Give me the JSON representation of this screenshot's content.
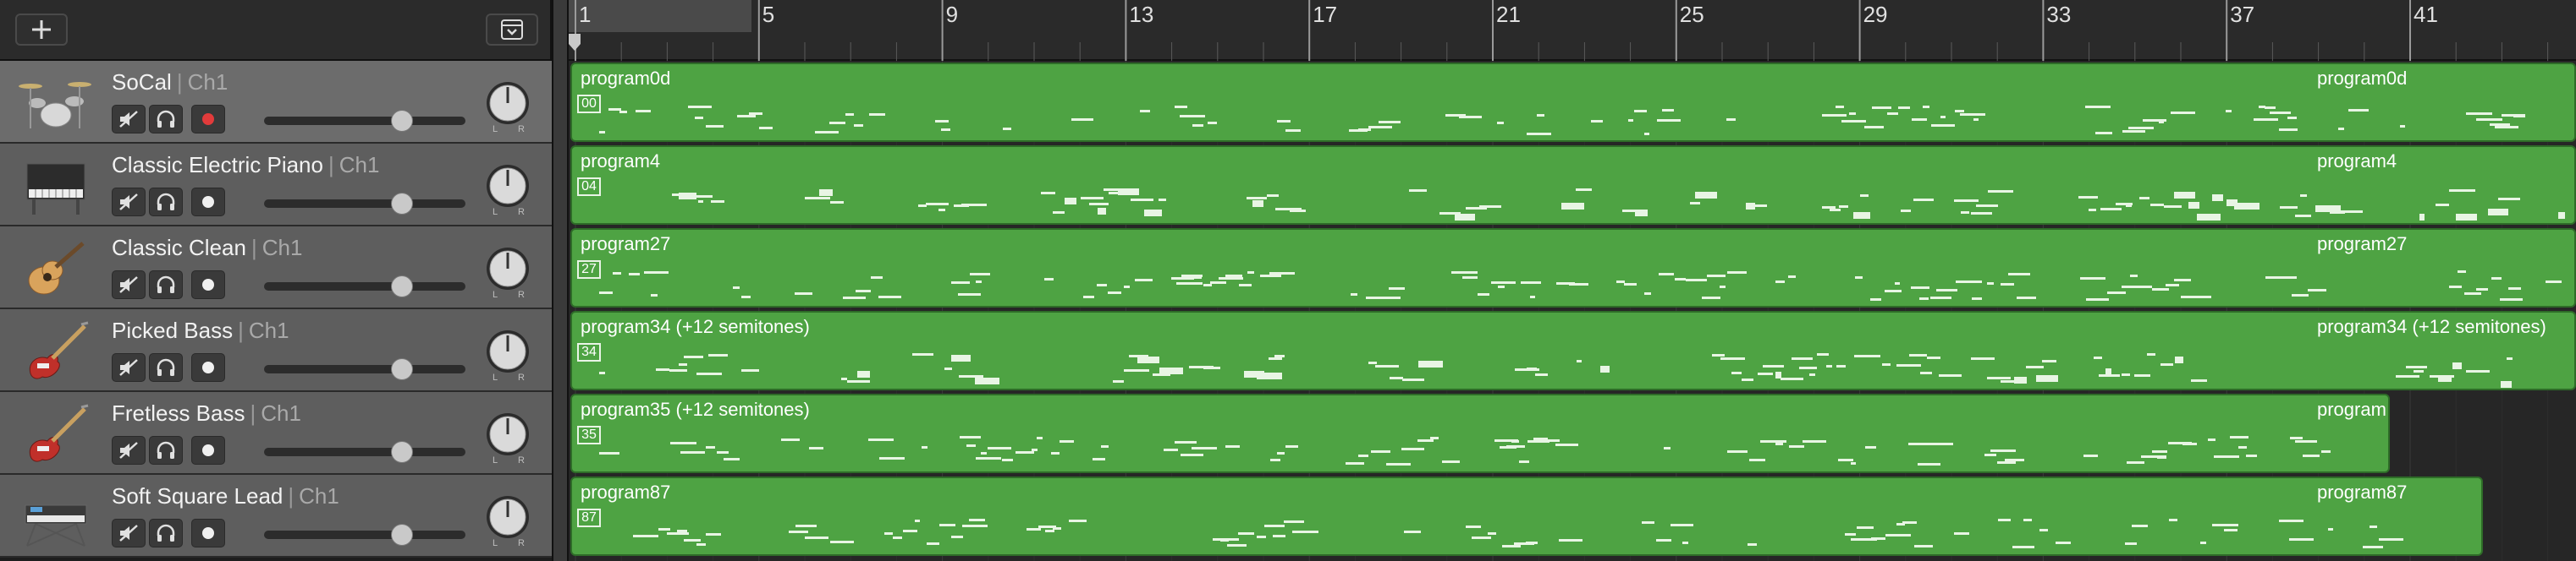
{
  "header": {
    "add_track_icon": "plus-icon",
    "collapse_icon": "chevron-down-box-icon"
  },
  "ruler": {
    "bars": [
      "1",
      "5",
      "9",
      "13",
      "17",
      "21",
      "25",
      "29",
      "33",
      "37",
      "41"
    ],
    "playhead_bar": "1"
  },
  "tracks": [
    {
      "name": "SoCal",
      "channel": "Ch1",
      "icon": "drum-kit-icon",
      "record_armed": true,
      "region": {
        "start": "program0d",
        "loop": "program0d",
        "box": "00"
      }
    },
    {
      "name": "Classic Electric Piano",
      "channel": "Ch1",
      "icon": "electric-piano-icon",
      "record_armed": false,
      "region": {
        "start": "program4",
        "loop": "program4",
        "box": "04"
      }
    },
    {
      "name": "Classic Clean",
      "channel": "Ch1",
      "icon": "guitar-icon",
      "record_armed": false,
      "region": {
        "start": "program27",
        "loop": "program27",
        "box": "27"
      }
    },
    {
      "name": "Picked Bass",
      "channel": "Ch1",
      "icon": "bass-guitar-icon",
      "record_armed": false,
      "region": {
        "start": "program34 (+12 semitones)",
        "loop": "program34 (+12 semitones)",
        "box": "34"
      }
    },
    {
      "name": "Fretless Bass",
      "channel": "Ch1",
      "icon": "bass-guitar-icon",
      "record_armed": false,
      "region": {
        "start": "program35 (+12 semitones)",
        "loop": "program",
        "box": "35"
      }
    },
    {
      "name": "Soft Square Lead",
      "channel": "Ch1",
      "icon": "keyboard-synth-icon",
      "record_armed": false,
      "region": {
        "start": "program87",
        "loop": "program87",
        "box": "87"
      }
    }
  ],
  "colors": {
    "region_green": "#4ea343",
    "record_red": "#e23b3b",
    "note_color": "#e8f5e4"
  }
}
